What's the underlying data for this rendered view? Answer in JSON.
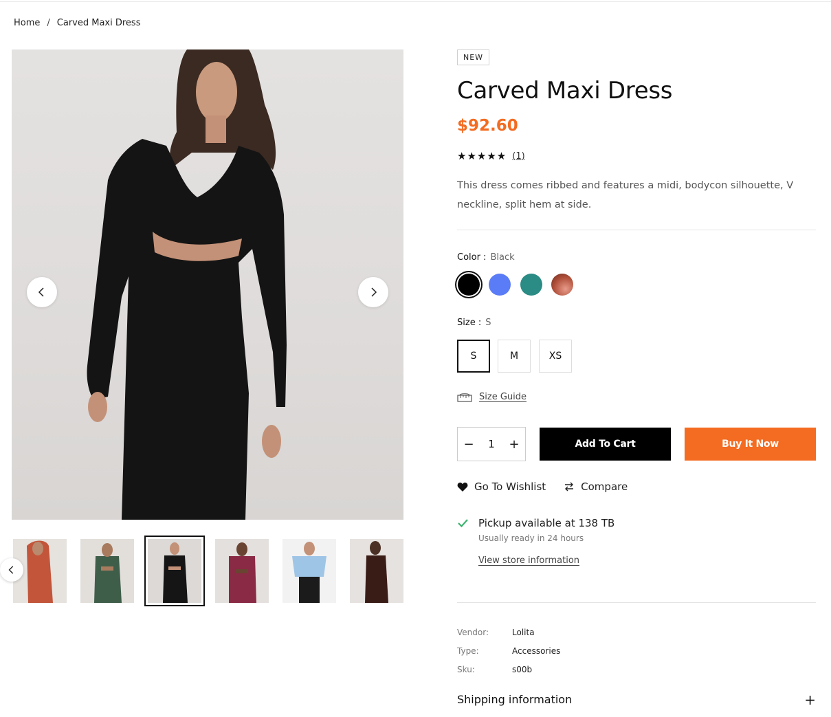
{
  "breadcrumb": {
    "home": "Home",
    "separator": "/",
    "current": "Carved Maxi Dress"
  },
  "product": {
    "badge": "NEW",
    "title": "Carved Maxi Dress",
    "price": "$92.60",
    "rating_stars": "★★★★★",
    "rating_value": 5,
    "review_count": "(1)",
    "description": "This dress comes ribbed and features a midi, bodycon silhouette, V neckline, split hem at side."
  },
  "color": {
    "label": "Color :",
    "selected": "Black",
    "swatches": [
      {
        "name": "Black",
        "color": "#000000"
      },
      {
        "name": "Blue",
        "color": "#5b7cf7"
      },
      {
        "name": "Teal",
        "color": "#2a8c84"
      },
      {
        "name": "Copper",
        "color": "#b0503a"
      }
    ]
  },
  "size": {
    "label": "Size :",
    "selected": "S",
    "options": [
      "S",
      "M",
      "XS"
    ]
  },
  "size_guide": "Size Guide",
  "quantity": {
    "value": "1",
    "minus": "−",
    "plus": "+"
  },
  "buttons": {
    "add_to_cart": "Add To Cart",
    "buy_now": "Buy It Now"
  },
  "actions": {
    "wishlist": "Go To Wishlist",
    "compare": "Compare"
  },
  "pickup": {
    "title": "Pickup available at 138 TB",
    "sub": "Usually ready in 24 hours",
    "link": "View store information"
  },
  "meta": [
    {
      "key": "Vendor:",
      "value": "Lolita"
    },
    {
      "key": "Type:",
      "value": "Accessories"
    },
    {
      "key": "Sku:",
      "value": "s00b"
    }
  ],
  "shipping": {
    "label": "Shipping information",
    "toggle": "+"
  },
  "colors": {
    "accent": "#f36c21",
    "dark": "#000000"
  },
  "thumbnails": [
    {
      "name": "rust-dress",
      "color": "#c2553a"
    },
    {
      "name": "green-dress",
      "color": "#3f5e4a"
    },
    {
      "name": "black-dress",
      "color": "#151515"
    },
    {
      "name": "burgundy-dress",
      "color": "#8a2a45"
    },
    {
      "name": "blue-sweater",
      "color": "#9ec5e6"
    },
    {
      "name": "brown-dress",
      "color": "#3a1c16"
    }
  ]
}
